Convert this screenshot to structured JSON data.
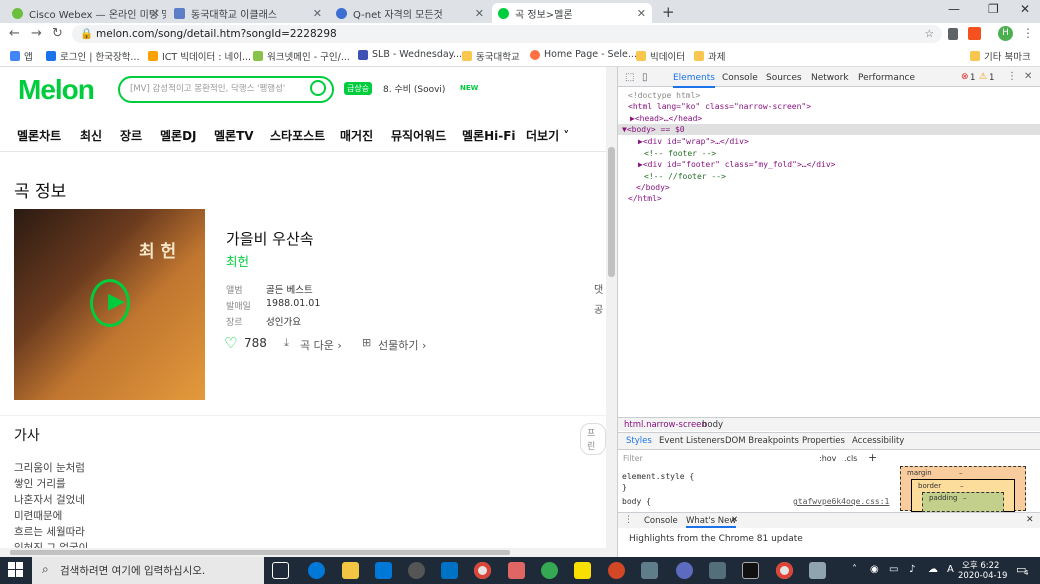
{
  "tabs": [
    {
      "label": "Cisco Webex — 온라인 미팅 및",
      "color": "#6cbf3f"
    },
    {
      "label": "동국대학교 이클래스",
      "color": "#5b7ec7"
    },
    {
      "label": "Q-net 자격의 모든것",
      "color": "#3b6fd1"
    },
    {
      "label": "곡 정보>멜론",
      "color": "#00cd3c"
    }
  ],
  "new_tab": "+",
  "window": {
    "minimize": "—",
    "restore": "❐",
    "close": "✕"
  },
  "url": "melon.com/song/detail.htm?songId=2228298",
  "bookmarks": [
    "앱",
    "로그인 | 한국장학...",
    "ICT 빅데이터 : 네이...",
    "워크넷메인 - 구인/...",
    "SLB - Wednesday...",
    "동국대학교",
    "Home Page - Sele...",
    "빅데이터",
    "과제",
    "기타 북마크"
  ],
  "melon": {
    "logo": "Melon",
    "search_placeholder": "[MV] 감성적이고 몽환적인, 닥행스 '펭행성'",
    "rank_badge": "급상승",
    "rank_text": "8. 수비 (Soovi)",
    "rank_new": "NEW",
    "nav": [
      "멜론차트",
      "최신",
      "장르",
      "멜론DJ",
      "멜론TV",
      "스타포스트",
      "매거진",
      "뮤직어워드",
      "멜론Hi-Fi",
      "더보기"
    ],
    "page_title": "곡 정보",
    "song_title": "가을비 우산속",
    "artist": "최헌",
    "meta": [
      {
        "k": "앨범",
        "v": "골든 베스트"
      },
      {
        "k": "발매일",
        "v": "1988.01.01"
      },
      {
        "k": "장르",
        "v": "성인가요"
      }
    ],
    "likes": "788",
    "download": "곡 다운",
    "gift": "선물하기",
    "side_text_1": "댓",
    "side_text_2": "공",
    "lyrics_heading": "가사",
    "lyrics_btn": "프린",
    "lyrics": [
      "그리움이 눈처럼",
      "쌓인 거리를",
      "나혼자서 걸었네",
      "미련때문에",
      "흐르는 세월따라",
      "잊혀진 그 얼굴이"
    ],
    "album_text": "최 헌"
  },
  "devtools": {
    "tabs": [
      "Elements",
      "Console",
      "Sources",
      "Network",
      "Performance"
    ],
    "errors": "1",
    "warnings": "1",
    "dom": [
      "<!doctype html>",
      "<html lang=\"ko\" class=\"narrow-screen\">",
      "▶<head>…</head>",
      "▼<body> == $0",
      "▶<div id=\"wrap\">…</div>",
      "<!-- footer -->",
      "▶<div id=\"footer\" class=\"my_fold\">…</div>",
      "<!-- //footer -->",
      "</body>",
      "</html>"
    ],
    "breadcrumb": [
      "html.narrow-screen",
      "body"
    ],
    "style_tabs": [
      "Styles",
      "Event Listeners",
      "DOM Breakpoints",
      "Properties",
      "Accessibility"
    ],
    "filter_placeholder": "Filter",
    "hov": ":hov",
    "cls": ".cls",
    "element_style": "element.style {",
    "close_brace": "}",
    "body_rule": "body {",
    "css_file": "gtafwvpe6k4oqe.css:1",
    "box_margin": "margin",
    "box_border": "border",
    "box_padding": "padding",
    "dash": "–",
    "drawer_tabs": [
      "Console",
      "What's New"
    ],
    "drawer_text": "Highlights from the Chrome 81 update"
  },
  "taskbar": {
    "search_placeholder": "검색하려면 여기에 입력하십시오.",
    "time": "오후 6:22",
    "date": "2020-04-19",
    "lang": "A",
    "notif": "4"
  }
}
